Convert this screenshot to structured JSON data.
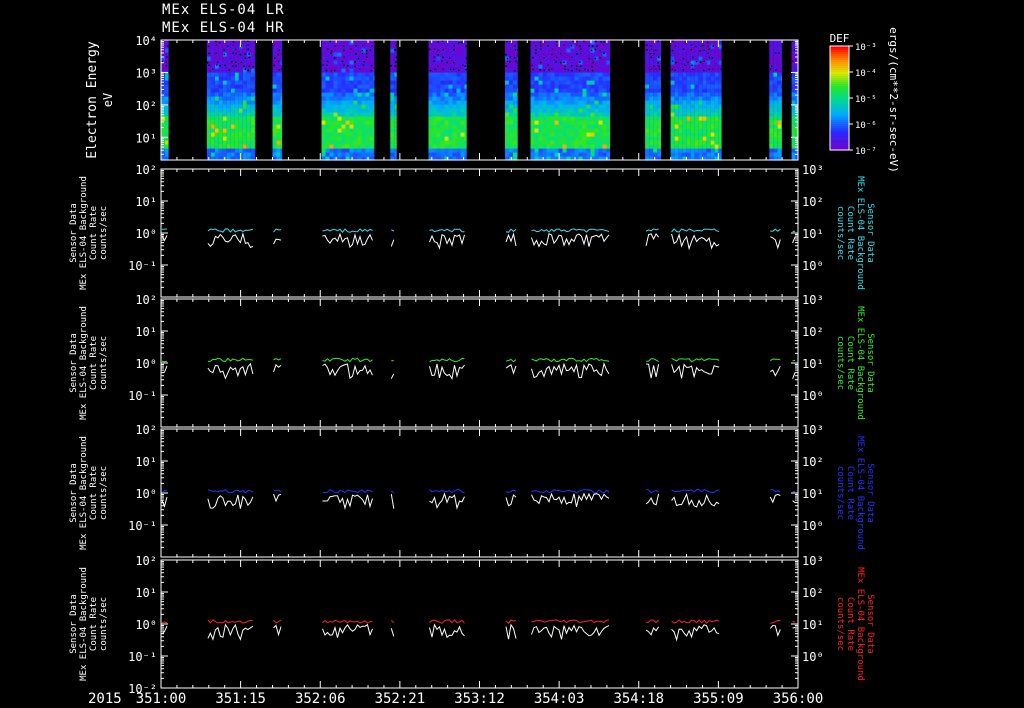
{
  "header": {
    "title_lines": [
      "MEx ELS-04 LR",
      "MEx ELS-04 HR"
    ]
  },
  "colors": {
    "background": "#000000",
    "axes": "#ffffff",
    "series_cyan": "#33e0f0",
    "series_green": "#33ee33",
    "series_blue": "#2233ff",
    "series_red": "#ff2222",
    "series_white": "#ffffff"
  },
  "colorbar": {
    "label": "DEF",
    "tick_labels": [
      "10⁻³",
      "10⁻⁴",
      "10⁻⁵",
      "10⁻⁶",
      "10⁻⁷"
    ],
    "units_label": "ergs/(cm**2-sr-sec-eV)"
  },
  "time_axis": {
    "year_label": "2015",
    "tick_labels": [
      "351:00",
      "351:15",
      "352:06",
      "352:21",
      "353:12",
      "354:03",
      "354:18",
      "355:09",
      "356:00"
    ]
  },
  "chart_data": [
    {
      "type": "heatmap",
      "panel": "spectrogram",
      "ylabel": "Electron Energy",
      "yunits": "eV",
      "yscale": "log",
      "ylim": [
        2,
        10000
      ],
      "ytick_labels": [
        "10⁴",
        "10³",
        "10²",
        "10¹"
      ],
      "colorscale": "rainbow",
      "zlim": [
        1e-07,
        0.001
      ],
      "data_intervals_frac": [
        [
          0.0,
          0.012
        ],
        [
          0.072,
          0.148
        ],
        [
          0.175,
          0.19
        ],
        [
          0.252,
          0.335
        ],
        [
          0.36,
          0.37
        ],
        [
          0.42,
          0.48
        ],
        [
          0.54,
          0.56
        ],
        [
          0.58,
          0.705
        ],
        [
          0.76,
          0.785
        ],
        [
          0.8,
          0.88
        ],
        [
          0.955,
          0.975
        ],
        [
          0.99,
          1.0
        ]
      ]
    },
    {
      "type": "line",
      "panel": "background-1",
      "ylabel_lines": [
        "Sensor Data",
        "MEx ELS-04 Background",
        "Count Rate",
        "counts/sec"
      ],
      "ylabel_right_lines": [
        "Sensor Data",
        "MEx ELS-04 Background",
        "Count Rate",
        "counts/sec"
      ],
      "yscale": "log",
      "ylim": [
        0.01,
        100
      ],
      "ylim_right": [
        0.1,
        1000
      ],
      "ytick_labels": [
        "10²",
        "10¹",
        "10⁰",
        "10⁻¹"
      ],
      "ytick_labels_right": [
        "10³",
        "10²",
        "10¹",
        "10⁰"
      ],
      "series": [
        {
          "color": "#33e0f0",
          "level": 1.2
        },
        {
          "color": "#ffffff",
          "level": 0.7
        }
      ]
    },
    {
      "type": "line",
      "panel": "background-2",
      "ylabel_lines": [
        "Sensor Data",
        "MEx ELS-04 Background",
        "Count Rate",
        "counts/sec"
      ],
      "ylabel_right_lines": [
        "Sensor Data",
        "MEx ELS-04 Background",
        "Count Rate",
        "counts/sec"
      ],
      "yscale": "log",
      "ylim": [
        0.01,
        100
      ],
      "ylim_right": [
        0.1,
        1000
      ],
      "ytick_labels": [
        "10²",
        "10¹",
        "10⁰",
        "10⁻¹"
      ],
      "ytick_labels_right": [
        "10³",
        "10²",
        "10¹",
        "10⁰"
      ],
      "series": [
        {
          "color": "#33ee33",
          "level": 1.25
        },
        {
          "color": "#ffffff",
          "level": 0.7
        }
      ]
    },
    {
      "type": "line",
      "panel": "background-3",
      "ylabel_lines": [
        "Sensor Data",
        "MEx ELS-04 Background",
        "Count Rate",
        "counts/sec"
      ],
      "ylabel_right_lines": [
        "Sensor Data",
        "MEx ELS-04 Background",
        "Count Rate",
        "counts/sec"
      ],
      "yscale": "log",
      "ylim": [
        0.01,
        100
      ],
      "ylim_right": [
        0.1,
        1000
      ],
      "ytick_labels": [
        "10²",
        "10¹",
        "10⁰",
        "10⁻¹"
      ],
      "ytick_labels_right": [
        "10³",
        "10²",
        "10¹",
        "10⁰"
      ],
      "series": [
        {
          "color": "#2233ff",
          "level": 1.15
        },
        {
          "color": "#ffffff",
          "level": 0.7
        }
      ]
    },
    {
      "type": "line",
      "panel": "background-4",
      "ylabel_lines": [
        "Sensor Data",
        "MEx ELS-04 Background",
        "Count Rate",
        "counts/sec"
      ],
      "ylabel_right_lines": [
        "Sensor Data",
        "MEx ELS-04 Background",
        "Count Rate",
        "counts/sec"
      ],
      "yscale": "log",
      "ylim": [
        0.01,
        100
      ],
      "ylim_right": [
        0.1,
        1000
      ],
      "ytick_labels": [
        "10²",
        "10¹",
        "10⁰",
        "10⁻¹",
        "10⁻²"
      ],
      "ytick_labels_right": [
        "10³",
        "10²",
        "10¹",
        "10⁰"
      ],
      "series": [
        {
          "color": "#ff2222",
          "level": 1.2
        },
        {
          "color": "#ffffff",
          "level": 0.7
        }
      ]
    }
  ]
}
